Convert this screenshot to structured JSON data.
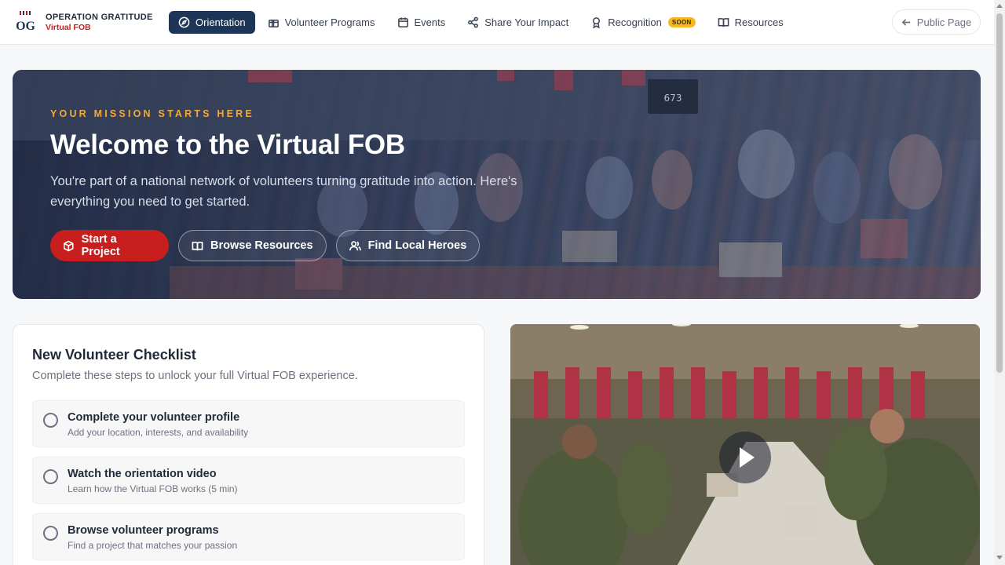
{
  "brand": {
    "name": "OPERATION GRATITUDE",
    "sub": "Virtual FOB",
    "logo_text": "OG"
  },
  "nav": {
    "items": [
      {
        "label": "Orientation",
        "icon": "compass-icon",
        "active": true
      },
      {
        "label": "Volunteer Programs",
        "icon": "gift-icon"
      },
      {
        "label": "Events",
        "icon": "calendar-icon"
      },
      {
        "label": "Share Your Impact",
        "icon": "share-icon"
      },
      {
        "label": "Recognition",
        "icon": "award-icon",
        "badge": "SOON"
      },
      {
        "label": "Resources",
        "icon": "book-icon"
      }
    ],
    "public_page": "Public Page"
  },
  "hero": {
    "eyebrow": "YOUR MISSION STARTS HERE",
    "title": "Welcome to the Virtual FOB",
    "description": "You're part of a national network of volunteers turning gratitude into action. Here's everything you need to get started.",
    "buttons": {
      "start": "Start a Project",
      "browse": "Browse Resources",
      "heroes": "Find Local Heroes"
    },
    "sign_number": "673"
  },
  "checklist": {
    "title": "New Volunteer Checklist",
    "subtitle": "Complete these steps to unlock your full Virtual FOB experience.",
    "items": [
      {
        "title": "Complete your volunteer profile",
        "desc": "Add your location, interests, and availability"
      },
      {
        "title": "Watch the orientation video",
        "desc": "Learn how the Virtual FOB works (5 min)"
      },
      {
        "title": "Browse volunteer programs",
        "desc": "Find a project that matches your passion"
      }
    ]
  },
  "colors": {
    "navy": "#1d3557",
    "red": "#c81e1e",
    "gold": "#f2a93b"
  }
}
